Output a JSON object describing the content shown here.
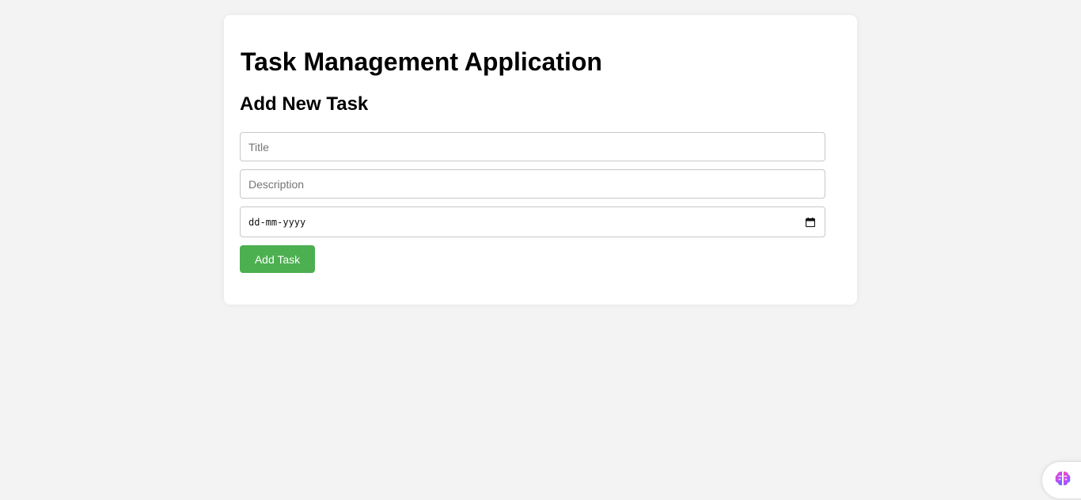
{
  "app": {
    "title": "Task Management Application"
  },
  "form": {
    "heading": "Add New Task",
    "title_field": {
      "value": "",
      "placeholder": "Title"
    },
    "description_field": {
      "value": "",
      "placeholder": "Description"
    },
    "date_field": {
      "value": "",
      "placeholder": "dd-mm-yyyy",
      "icon": "calendar-icon"
    },
    "submit_label": "Add Task"
  },
  "assistant_badge": {
    "icon": "brain-icon"
  },
  "colors": {
    "page_background": "#f3f3f3",
    "card_background": "#ffffff",
    "button_background": "#4caf50",
    "button_text": "#ffffff"
  }
}
